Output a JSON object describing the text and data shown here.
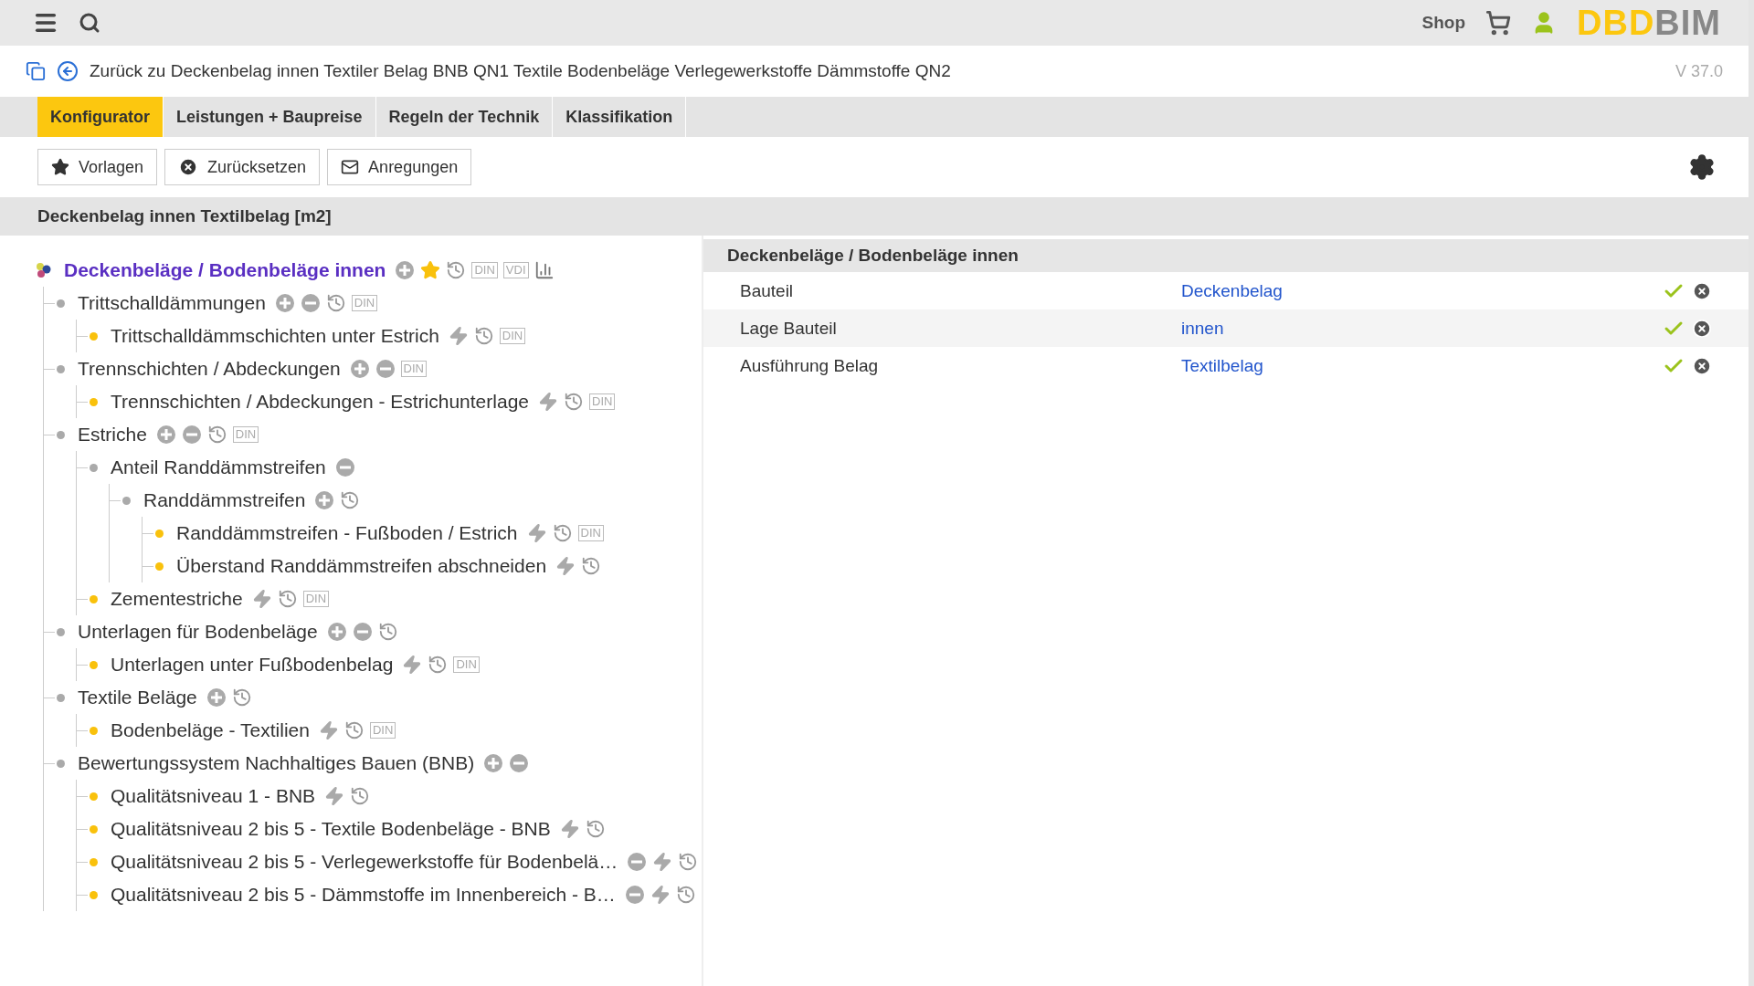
{
  "top_bar": {
    "shop": "Shop",
    "logo": {
      "first": "DBD",
      "second": "BIM"
    }
  },
  "breadcrumb": {
    "text": "Zurück zu Deckenbelag innen Textiler Belag BNB QN1 Textile Bodenbeläge Verlegewerkstoffe Dämmstoffe QN2",
    "version": "V 37.0"
  },
  "tabs": [
    {
      "label": "Konfigurator",
      "selected": true
    },
    {
      "label": "Leistungen + Baupreise",
      "selected": false
    },
    {
      "label": "Regeln der Technik",
      "selected": false
    },
    {
      "label": "Klassifikation",
      "selected": false
    }
  ],
  "toolbar": [
    {
      "kind": "star",
      "label": "Vorlagen"
    },
    {
      "kind": "reset",
      "label": "Zurücksetzen"
    },
    {
      "kind": "mail",
      "label": "Anregungen"
    }
  ],
  "section_title": "Deckenbelag innen Textilbelag [m2]",
  "tree": {
    "kind": "root",
    "label": "Deckenbeläge / Bodenbeläge innen",
    "actions": [
      {
        "kind": "add"
      },
      {
        "kind": "star"
      },
      {
        "kind": "history"
      }
    ],
    "badges": [
      "DIN",
      "VDI"
    ],
    "chart": true,
    "children": [
      {
        "kind": "group",
        "label": "Trittschalldämmungen",
        "actions": [
          {
            "kind": "add"
          },
          {
            "kind": "remove"
          },
          {
            "kind": "history"
          }
        ],
        "badges": [
          "DIN"
        ],
        "children": [
          {
            "kind": "leaf",
            "label": "Trittschalldämmschichten unter Estrich",
            "actions": [
              {
                "kind": "bolt"
              },
              {
                "kind": "history"
              }
            ],
            "badges": [
              "DIN"
            ]
          }
        ]
      },
      {
        "kind": "group",
        "label": "Trennschichten / Abdeckungen",
        "actions": [
          {
            "kind": "add"
          },
          {
            "kind": "remove"
          }
        ],
        "badges": [
          "DIN"
        ],
        "children": [
          {
            "kind": "leaf",
            "label": "Trennschichten / Abdeckungen - Estrichunterlage",
            "actions": [
              {
                "kind": "bolt"
              },
              {
                "kind": "history"
              }
            ],
            "badges": [
              "DIN"
            ]
          }
        ]
      },
      {
        "kind": "group",
        "label": "Estriche",
        "actions": [
          {
            "kind": "add"
          },
          {
            "kind": "remove"
          },
          {
            "kind": "history"
          }
        ],
        "badges": [
          "DIN"
        ],
        "children": [
          {
            "kind": "group",
            "label": "Anteil Randdämmstreifen",
            "actions": [
              {
                "kind": "remove"
              }
            ],
            "children": [
              {
                "kind": "group",
                "label": "Randdämmstreifen",
                "actions": [
                  {
                    "kind": "add"
                  },
                  {
                    "kind": "history"
                  }
                ],
                "children": [
                  {
                    "kind": "leaf",
                    "label": "Randdämmstreifen - Fußboden / Estrich",
                    "actions": [
                      {
                        "kind": "bolt"
                      },
                      {
                        "kind": "history"
                      }
                    ],
                    "badges": [
                      "DIN"
                    ]
                  },
                  {
                    "kind": "leaf",
                    "label": "Überstand Randdämmstreifen abschneiden",
                    "actions": [
                      {
                        "kind": "bolt"
                      },
                      {
                        "kind": "history"
                      }
                    ]
                  }
                ]
              }
            ]
          },
          {
            "kind": "leaf",
            "label": "Zementestriche",
            "actions": [
              {
                "kind": "bolt"
              },
              {
                "kind": "history"
              }
            ],
            "badges": [
              "DIN"
            ]
          }
        ]
      },
      {
        "kind": "group",
        "label": "Unterlagen für Bodenbeläge",
        "actions": [
          {
            "kind": "add"
          },
          {
            "kind": "remove"
          },
          {
            "kind": "history"
          }
        ],
        "children": [
          {
            "kind": "leaf",
            "label": "Unterlagen unter Fußbodenbelag",
            "actions": [
              {
                "kind": "bolt"
              },
              {
                "kind": "history"
              }
            ],
            "badges": [
              "DIN"
            ]
          }
        ]
      },
      {
        "kind": "group",
        "label": "Textile Beläge",
        "actions": [
          {
            "kind": "add"
          },
          {
            "kind": "history"
          }
        ],
        "children": [
          {
            "kind": "leaf",
            "label": "Bodenbeläge - Textilien",
            "actions": [
              {
                "kind": "bolt"
              },
              {
                "kind": "history"
              }
            ],
            "badges": [
              "DIN"
            ]
          }
        ]
      },
      {
        "kind": "group",
        "label": "Bewertungssystem Nachhaltiges Bauen (BNB)",
        "actions": [
          {
            "kind": "add"
          },
          {
            "kind": "remove"
          }
        ],
        "children": [
          {
            "kind": "leaf",
            "label": "Qualitätsniveau 1 - BNB",
            "actions": [
              {
                "kind": "bolt"
              },
              {
                "kind": "history"
              }
            ]
          },
          {
            "kind": "leaf",
            "label": "Qualitätsniveau 2 bis 5 - Textile Bodenbeläge - BNB",
            "actions": [
              {
                "kind": "bolt"
              },
              {
                "kind": "history"
              }
            ]
          },
          {
            "kind": "leaf",
            "label": "Qualitätsniveau 2 bis 5 - Verlegewerkstoffe für Bodenbelä…",
            "actions": [
              {
                "kind": "remove"
              },
              {
                "kind": "bolt"
              },
              {
                "kind": "history"
              }
            ]
          },
          {
            "kind": "leaf",
            "label": "Qualitätsniveau 2 bis 5 - Dämmstoffe im Innenbereich - B…",
            "actions": [
              {
                "kind": "remove"
              },
              {
                "kind": "bolt"
              },
              {
                "kind": "history"
              }
            ]
          }
        ]
      }
    ]
  },
  "properties": {
    "title": "Deckenbeläge / Bodenbeläge innen",
    "rows": [
      {
        "label": "Bauteil",
        "value": "Deckenbelag",
        "confirmed": true
      },
      {
        "label": "Lage Bauteil",
        "value": "innen",
        "confirmed": true
      },
      {
        "label": "Ausführung Belag",
        "value": "Textilbelag",
        "confirmed": true
      }
    ]
  }
}
